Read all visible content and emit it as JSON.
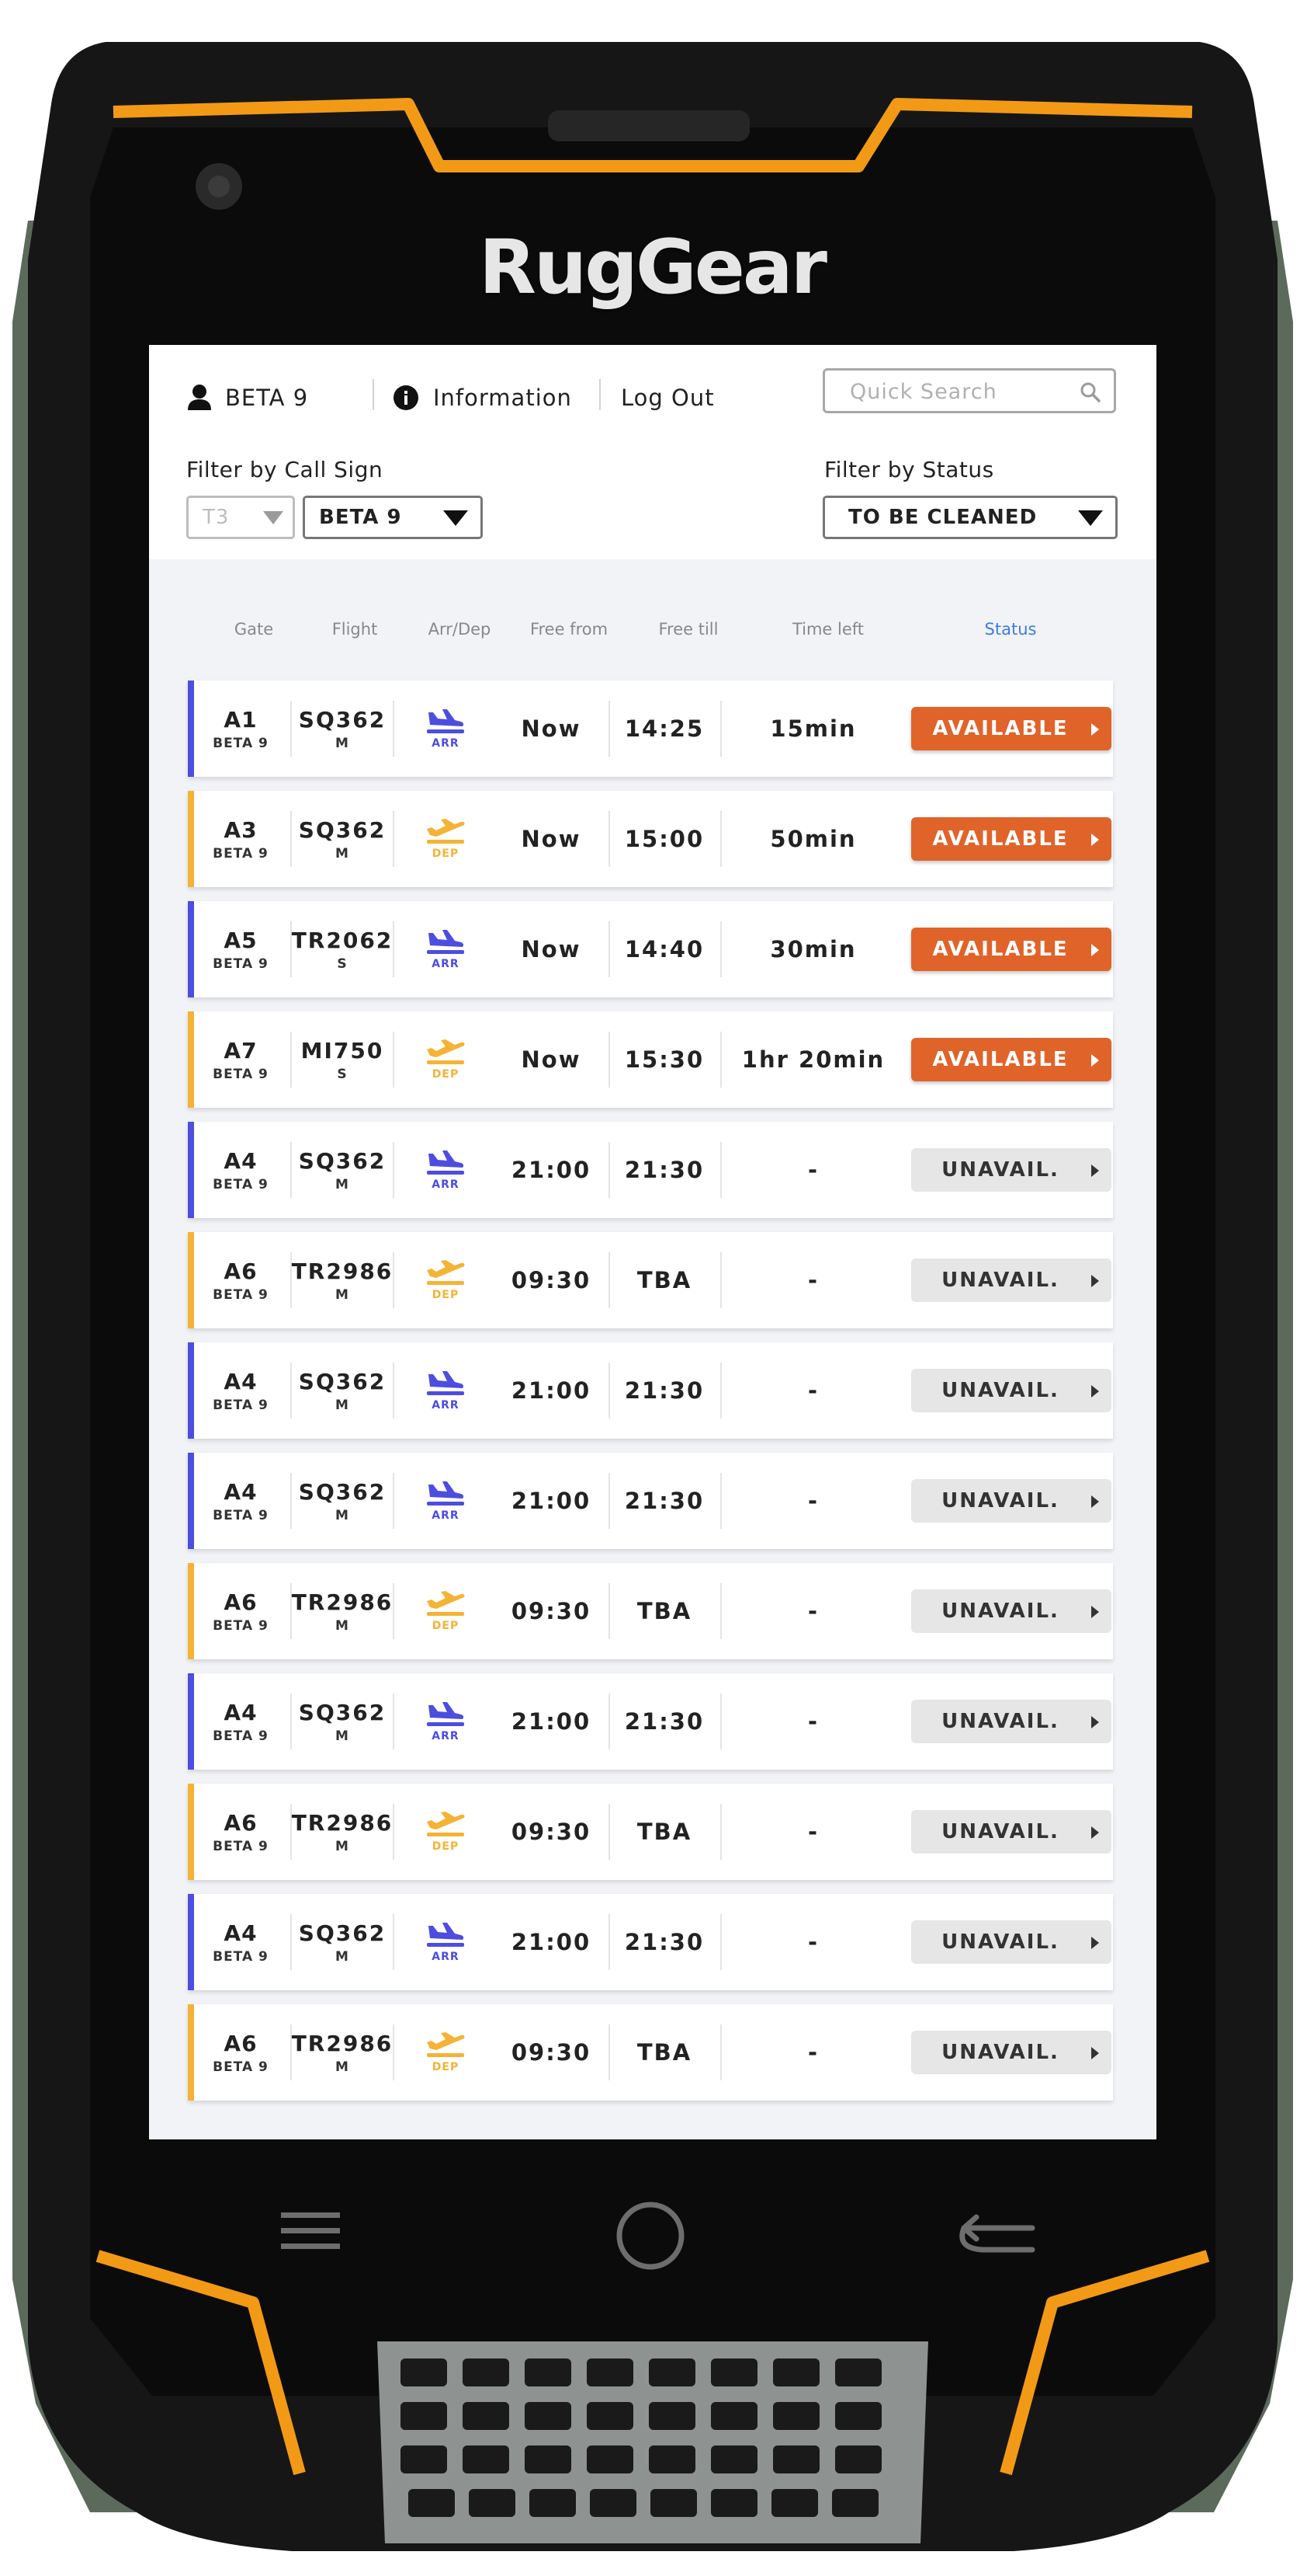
{
  "device": {
    "brand": "RugGear"
  },
  "topbar": {
    "user": "BETA 9",
    "info_link": "Information",
    "logout_link": "Log Out",
    "search_placeholder": "Quick Search"
  },
  "filters": {
    "call_sign_label": "Filter by Call Sign",
    "terminal_value": "T3",
    "call_sign_value": "BETA 9",
    "status_label": "Filter by Status",
    "status_value": "TO BE CLEANED"
  },
  "table": {
    "headers": [
      "Gate",
      "Flight",
      "Arr/Dep",
      "Free from",
      "Free till",
      "Time left",
      "Status"
    ],
    "rows": [
      {
        "gate": "A1",
        "callsign": "BETA 9",
        "flight": "SQ362",
        "size": "M",
        "dir": "ARR",
        "free_from": "Now",
        "free_till": "14:25",
        "time_left": "15min",
        "status": "AVAILABLE"
      },
      {
        "gate": "A3",
        "callsign": "BETA 9",
        "flight": "SQ362",
        "size": "M",
        "dir": "DEP",
        "free_from": "Now",
        "free_till": "15:00",
        "time_left": "50min",
        "status": "AVAILABLE"
      },
      {
        "gate": "A5",
        "callsign": "BETA 9",
        "flight": "TR2062",
        "size": "S",
        "dir": "ARR",
        "free_from": "Now",
        "free_till": "14:40",
        "time_left": "30min",
        "status": "AVAILABLE"
      },
      {
        "gate": "A7",
        "callsign": "BETA 9",
        "flight": "MI750",
        "size": "S",
        "dir": "DEP",
        "free_from": "Now",
        "free_till": "15:30",
        "time_left": "1hr 20min",
        "status": "AVAILABLE"
      },
      {
        "gate": "A4",
        "callsign": "BETA 9",
        "flight": "SQ362",
        "size": "M",
        "dir": "ARR",
        "free_from": "21:00",
        "free_till": "21:30",
        "time_left": "-",
        "status": "UNAVAIL."
      },
      {
        "gate": "A6",
        "callsign": "BETA 9",
        "flight": "TR2986",
        "size": "M",
        "dir": "DEP",
        "free_from": "09:30",
        "free_till": "TBA",
        "time_left": "-",
        "status": "UNAVAIL."
      },
      {
        "gate": "A4",
        "callsign": "BETA 9",
        "flight": "SQ362",
        "size": "M",
        "dir": "ARR",
        "free_from": "21:00",
        "free_till": "21:30",
        "time_left": "-",
        "status": "UNAVAIL."
      },
      {
        "gate": "A4",
        "callsign": "BETA 9",
        "flight": "SQ362",
        "size": "M",
        "dir": "ARR",
        "free_from": "21:00",
        "free_till": "21:30",
        "time_left": "-",
        "status": "UNAVAIL."
      },
      {
        "gate": "A6",
        "callsign": "BETA 9",
        "flight": "TR2986",
        "size": "M",
        "dir": "DEP",
        "free_from": "09:30",
        "free_till": "TBA",
        "time_left": "-",
        "status": "UNAVAIL."
      },
      {
        "gate": "A4",
        "callsign": "BETA 9",
        "flight": "SQ362",
        "size": "M",
        "dir": "ARR",
        "free_from": "21:00",
        "free_till": "21:30",
        "time_left": "-",
        "status": "UNAVAIL."
      },
      {
        "gate": "A6",
        "callsign": "BETA 9",
        "flight": "TR2986",
        "size": "M",
        "dir": "DEP",
        "free_from": "09:30",
        "free_till": "TBA",
        "time_left": "-",
        "status": "UNAVAIL."
      },
      {
        "gate": "A4",
        "callsign": "BETA 9",
        "flight": "SQ362",
        "size": "M",
        "dir": "ARR",
        "free_from": "21:00",
        "free_till": "21:30",
        "time_left": "-",
        "status": "UNAVAIL."
      },
      {
        "gate": "A6",
        "callsign": "BETA 9",
        "flight": "TR2986",
        "size": "M",
        "dir": "DEP",
        "free_from": "09:30",
        "free_till": "TBA",
        "time_left": "-",
        "status": "UNAVAIL."
      }
    ]
  },
  "colors": {
    "arr": "#4d4de0",
    "dep": "#f5b335",
    "available": "#e0632a",
    "unavailable": "#e6e6e6",
    "status_header": "#3b7ddd"
  },
  "icons": {
    "arr": "plane-landing-icon",
    "dep": "plane-takeoff-icon",
    "user": "user-icon",
    "info": "info-icon",
    "search": "search-icon",
    "nav_menu": "menu-icon",
    "nav_home": "home-icon",
    "nav_back": "back-icon"
  }
}
